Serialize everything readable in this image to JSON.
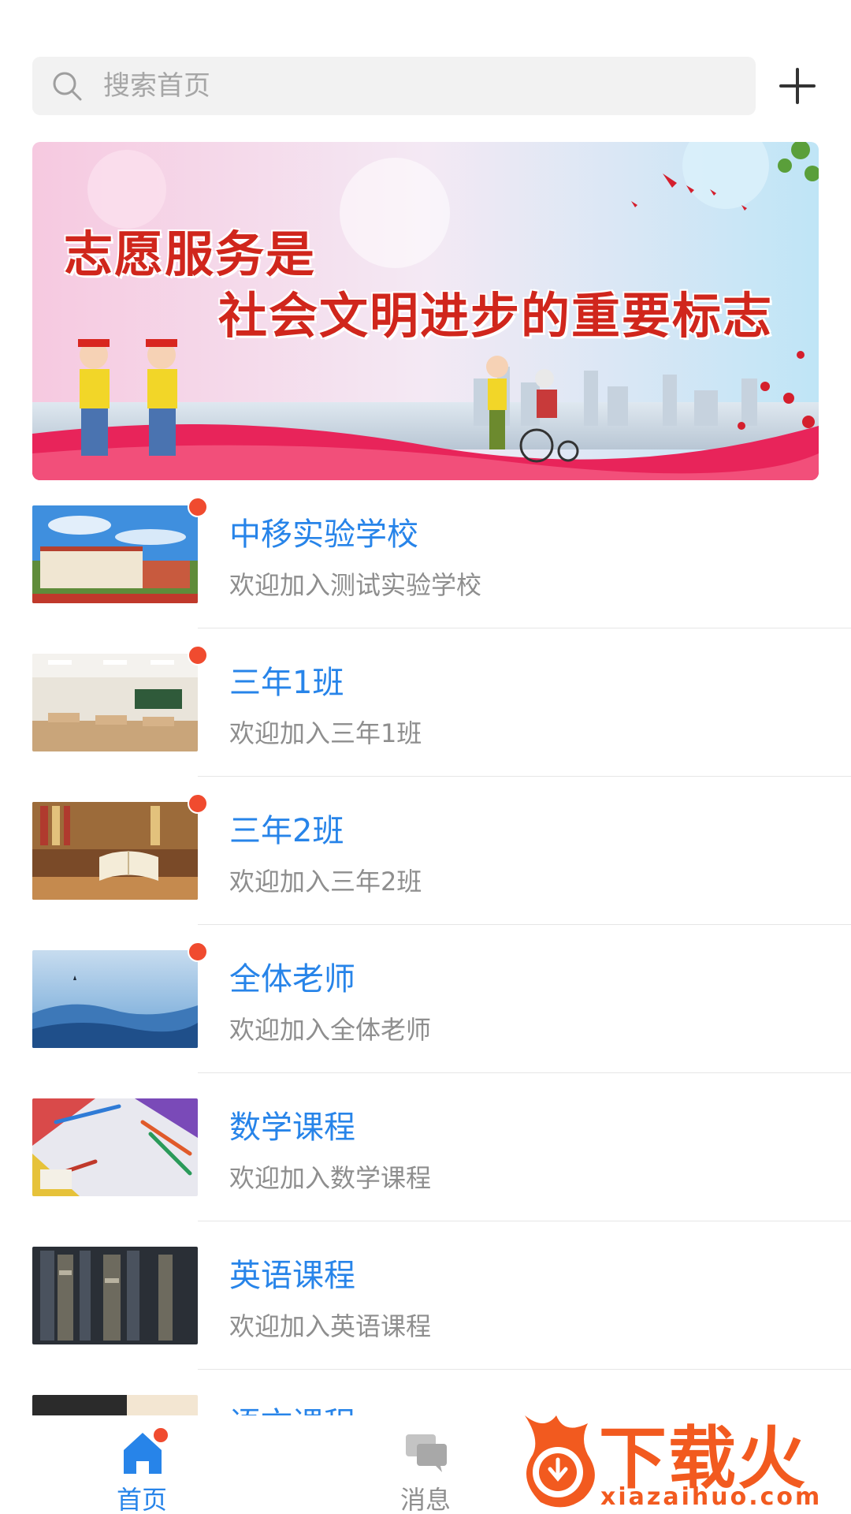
{
  "search": {
    "placeholder": "搜索首页"
  },
  "banner": {
    "line1": "志愿服务是",
    "line2": "社会文明进步的重要标志"
  },
  "list": {
    "items": [
      {
        "title": "中移实验学校",
        "subtitle": "欢迎加入测试实验学校",
        "unread": true
      },
      {
        "title": "三年1班",
        "subtitle": "欢迎加入三年1班",
        "unread": true
      },
      {
        "title": "三年2班",
        "subtitle": "欢迎加入三年2班",
        "unread": true
      },
      {
        "title": "全体老师",
        "subtitle": "欢迎加入全体老师",
        "unread": true
      },
      {
        "title": "数学课程",
        "subtitle": "欢迎加入数学课程",
        "unread": false
      },
      {
        "title": "英语课程",
        "subtitle": "欢迎加入英语课程",
        "unread": false
      },
      {
        "title": "语文课程",
        "subtitle": "",
        "unread": false
      }
    ]
  },
  "tabbar": {
    "home_label": "首页",
    "messages_label": "消息",
    "home_has_badge": true
  },
  "watermark": {
    "brand": "下载火",
    "url": "xiazaihuo.com"
  },
  "colors": {
    "accent": "#2784e9",
    "badge": "#f04b2f",
    "watermark": "#f25a1f"
  }
}
